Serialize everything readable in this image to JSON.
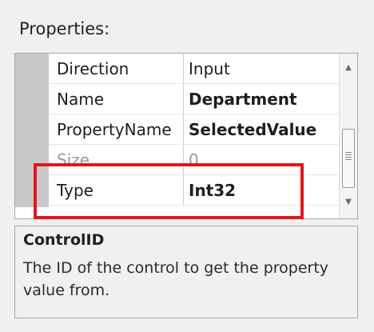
{
  "panel": {
    "label": "Properties:"
  },
  "properties": [
    {
      "name": "Direction",
      "value": "Input",
      "bold": false
    },
    {
      "name": "Name",
      "value": "Department",
      "bold": true
    },
    {
      "name": "PropertyName",
      "value": "SelectedValue",
      "bold": true
    },
    {
      "name": "Size",
      "value": "0",
      "bold": false
    },
    {
      "name": "Type",
      "value": "Int32",
      "bold": true
    }
  ],
  "scrollbar": {
    "up_icon": "scroll-up-arrow",
    "down_icon": "scroll-down-arrow"
  },
  "annotation": {
    "color": "#e2161b"
  },
  "help": {
    "title": "ControlID",
    "description": "The ID of the control to get the property value from."
  }
}
